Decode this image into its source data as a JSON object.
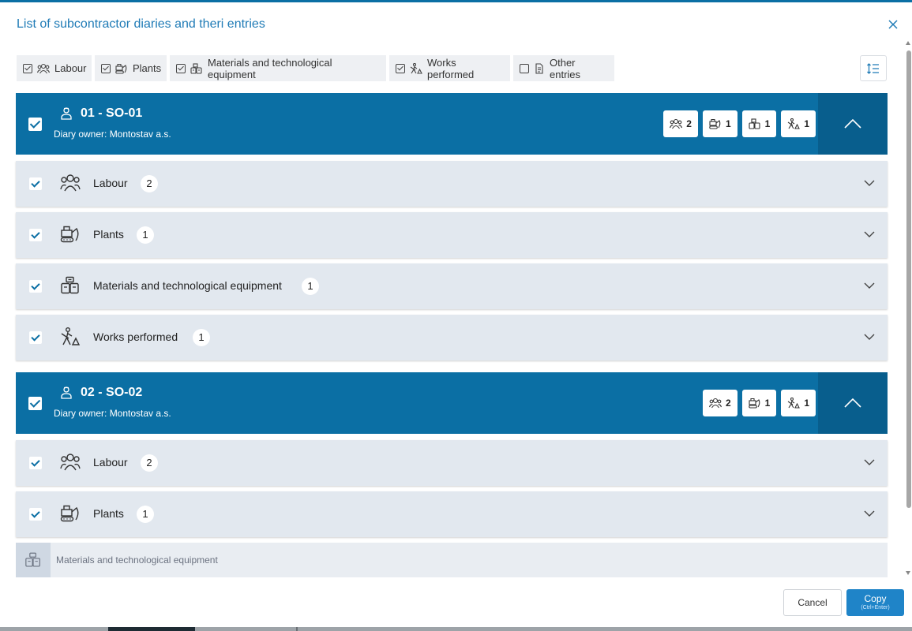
{
  "dialog": {
    "title": "List of subcontractor diaries and theri entries"
  },
  "filters": [
    {
      "label": "Labour",
      "checked": true,
      "icon": "workers-icon"
    },
    {
      "label": "Plants",
      "checked": true,
      "icon": "excavator-icon"
    },
    {
      "label": "Materials and technological equipment",
      "checked": true,
      "icon": "materials-icon"
    },
    {
      "label": "Works performed",
      "checked": true,
      "icon": "worker-digging-icon"
    },
    {
      "label": "Other entries",
      "checked": false,
      "icon": "document-icon"
    }
  ],
  "diaries": [
    {
      "name": "01 - SO-01",
      "owner": "Diary owner: Montostav a.s.",
      "checked": true,
      "badges": [
        {
          "icon": "workers-icon",
          "count": "2"
        },
        {
          "icon": "excavator-icon",
          "count": "1"
        },
        {
          "icon": "materials-icon",
          "count": "1"
        },
        {
          "icon": "worker-digging-icon",
          "count": "1"
        }
      ],
      "sections": [
        {
          "label": "Labour",
          "count": "2",
          "checked": true,
          "icon": "workers-icon"
        },
        {
          "label": "Plants",
          "count": "1",
          "checked": true,
          "icon": "excavator-icon"
        },
        {
          "label": "Materials and technological equipment",
          "count": "1",
          "checked": true,
          "icon": "materials-icon"
        },
        {
          "label": "Works performed",
          "count": "1",
          "checked": true,
          "icon": "worker-digging-icon"
        }
      ]
    },
    {
      "name": "02 - SO-02",
      "owner": "Diary owner: Montostav a.s.",
      "checked": true,
      "badges": [
        {
          "icon": "workers-icon",
          "count": "2"
        },
        {
          "icon": "excavator-icon",
          "count": "1"
        },
        {
          "icon": "worker-digging-icon",
          "count": "1"
        }
      ],
      "sections": [
        {
          "label": "Labour",
          "count": "2",
          "checked": true,
          "icon": "workers-icon"
        },
        {
          "label": "Plants",
          "count": "1",
          "checked": true,
          "icon": "excavator-icon"
        },
        {
          "label": "Materials and technological equipment",
          "disabled": true,
          "icon": "materials-icon"
        }
      ]
    }
  ],
  "footer": {
    "cancel_label": "Cancel",
    "copy_label": "Copy",
    "copy_shortcut": "(Ctrl+Enter)"
  },
  "colors": {
    "header_blue": "#0b6fa4",
    "header_blue_dark": "#085e8d",
    "section_bg": "#e2e8ef",
    "primary_button": "#1f84c8",
    "title_blue": "#1f7bb6"
  }
}
